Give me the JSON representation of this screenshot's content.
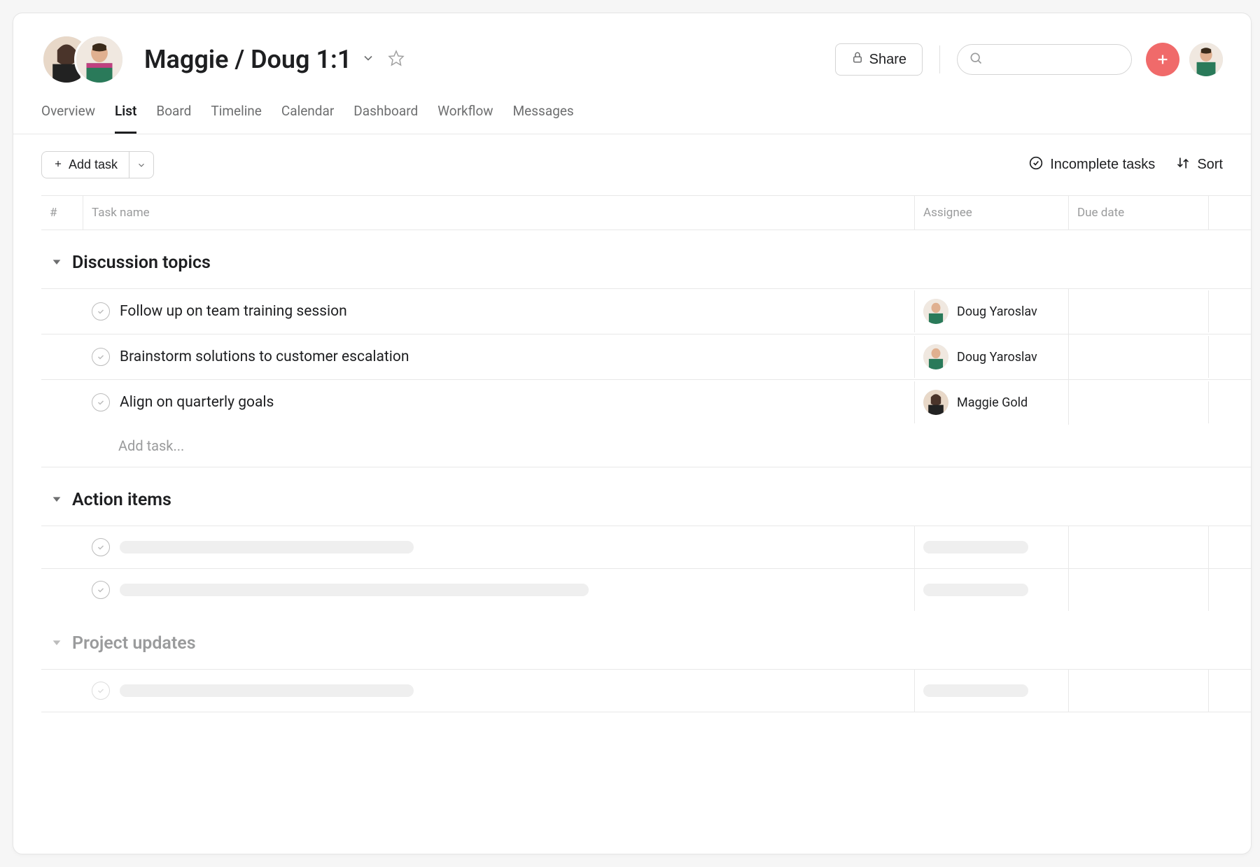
{
  "header": {
    "title": "Maggie / Doug 1:1",
    "share_label": "Share",
    "search_placeholder": ""
  },
  "tabs": [
    {
      "label": "Overview",
      "active": false
    },
    {
      "label": "List",
      "active": true
    },
    {
      "label": "Board",
      "active": false
    },
    {
      "label": "Timeline",
      "active": false
    },
    {
      "label": "Calendar",
      "active": false
    },
    {
      "label": "Dashboard",
      "active": false
    },
    {
      "label": "Workflow",
      "active": false
    },
    {
      "label": "Messages",
      "active": false
    }
  ],
  "toolbar": {
    "add_task_label": "Add task",
    "filter_label": "Incomplete tasks",
    "sort_label": "Sort"
  },
  "columns": {
    "num": "#",
    "task_name": "Task name",
    "assignee": "Assignee",
    "due_date": "Due date"
  },
  "sections": [
    {
      "title": "Discussion topics",
      "muted": false,
      "tasks": [
        {
          "name": "Follow up on team training session",
          "assignee": "Doug Yaroslav",
          "assignee_avatar": "doug"
        },
        {
          "name": "Brainstorm solutions to customer escalation",
          "assignee": "Doug Yaroslav",
          "assignee_avatar": "doug"
        },
        {
          "name": "Align on quarterly goals",
          "assignee": "Maggie Gold",
          "assignee_avatar": "maggie"
        }
      ],
      "add_task_label": "Add task..."
    },
    {
      "title": "Action items",
      "muted": false,
      "tasks": [
        {
          "placeholder": true,
          "width": "sk-name-1"
        },
        {
          "placeholder": true,
          "width": "sk-name-2"
        }
      ]
    },
    {
      "title": "Project updates",
      "muted": true,
      "tasks": [
        {
          "placeholder": true,
          "width": "sk-name-1",
          "light": true
        }
      ]
    }
  ]
}
